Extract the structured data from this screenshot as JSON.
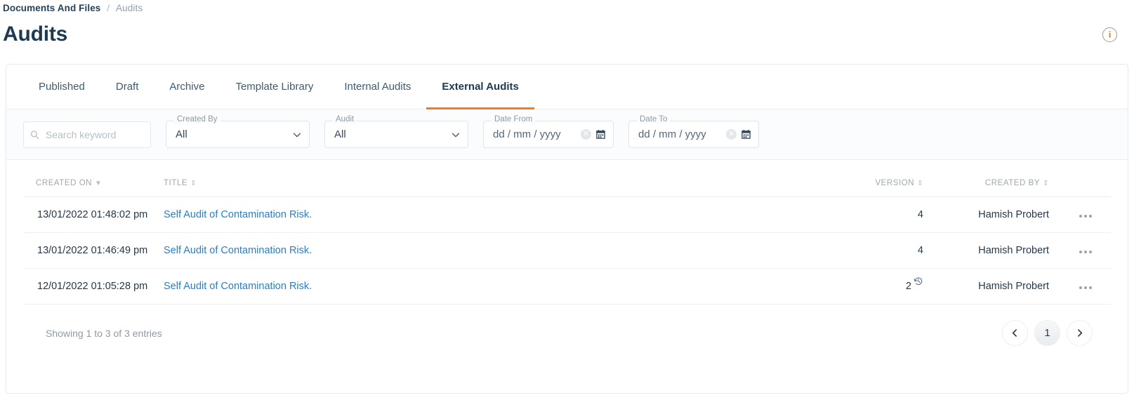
{
  "breadcrumb": {
    "parent": "Documents And Files",
    "separator": "/",
    "current": "Audits"
  },
  "header": {
    "title": "Audits",
    "info_icon_label": "i"
  },
  "tabs": [
    {
      "label": "Published",
      "active": false
    },
    {
      "label": "Draft",
      "active": false
    },
    {
      "label": "Archive",
      "active": false
    },
    {
      "label": "Template Library",
      "active": false
    },
    {
      "label": "Internal Audits",
      "active": false
    },
    {
      "label": "External Audits",
      "active": true
    }
  ],
  "filters": {
    "search": {
      "placeholder": "Search keyword",
      "value": ""
    },
    "created_by": {
      "legend": "Created By",
      "value": "All"
    },
    "audit": {
      "legend": "Audit",
      "value": "All"
    },
    "date_from": {
      "legend": "Date From",
      "value": "dd / mm / yyyy"
    },
    "date_to": {
      "legend": "Date To",
      "value": "dd / mm / yyyy"
    }
  },
  "table": {
    "columns": [
      {
        "label": "CREATED ON",
        "sort": "desc"
      },
      {
        "label": "TITLE",
        "sort": "both"
      },
      {
        "label": "VERSION",
        "sort": "both"
      },
      {
        "label": "CREATED BY",
        "sort": "both"
      },
      {
        "label": ""
      }
    ],
    "rows": [
      {
        "created_on": "13/01/2022 01:48:02 pm",
        "title": "Self Audit of Contamination Risk.",
        "version": "4",
        "has_history": false,
        "created_by": "Hamish Probert"
      },
      {
        "created_on": "13/01/2022 01:46:49 pm",
        "title": "Self Audit of Contamination Risk.",
        "version": "4",
        "has_history": false,
        "created_by": "Hamish Probert"
      },
      {
        "created_on": "12/01/2022 01:05:28 pm",
        "title": "Self Audit of Contamination Risk.",
        "version": "2",
        "has_history": true,
        "created_by": "Hamish Probert"
      }
    ]
  },
  "footer": {
    "showing": "Showing 1 to 3 of 3 entries",
    "page_current": "1"
  },
  "colors": {
    "accent": "#ef7d22",
    "link": "#2a7fc4",
    "text": "#23384b",
    "muted": "#9aa8b3"
  }
}
